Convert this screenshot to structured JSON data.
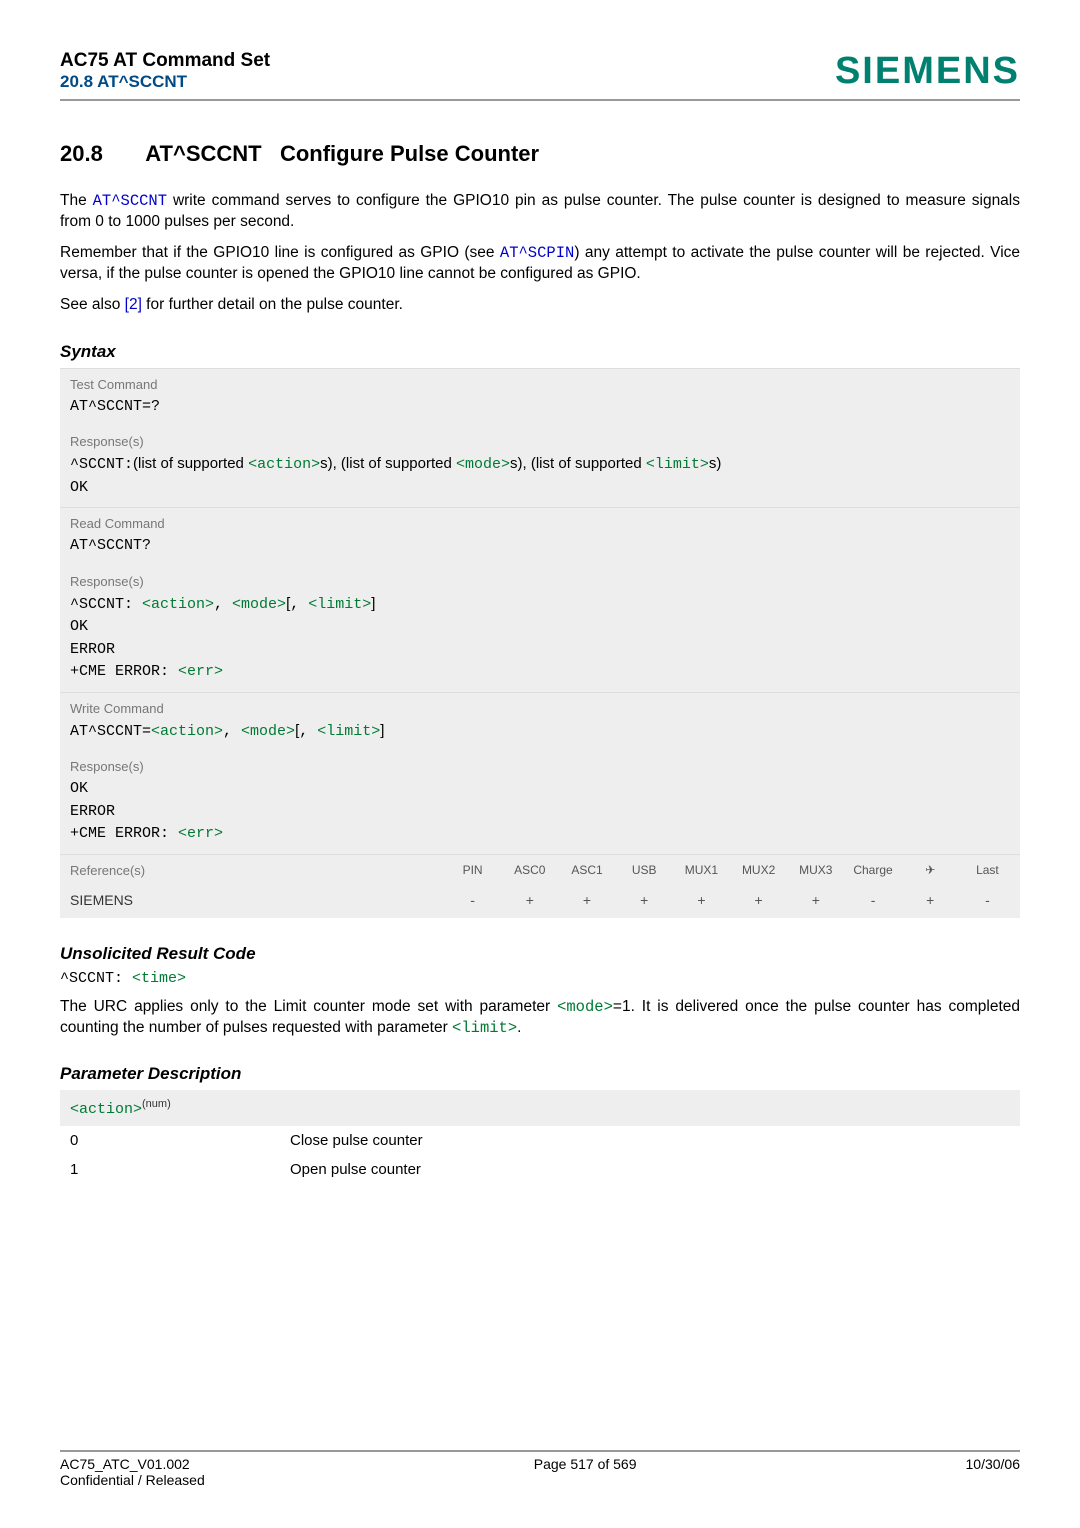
{
  "header": {
    "doc_title": "AC75 AT Command Set",
    "doc_sub": "20.8 AT^SCCNT",
    "brand": "SIEMENS"
  },
  "section": {
    "number": "20.8",
    "cmd": "AT^SCCNT",
    "name": "Configure Pulse Counter"
  },
  "intro": {
    "p1a": "The ",
    "p1b": " write command serves to configure the GPIO10 pin as pulse counter. The pulse counter is designed to measure signals from 0 to 1000 pulses per second.",
    "p2a": "Remember that if the GPIO10 line is configured as GPIO (see ",
    "p2b": ") any attempt to activate the pulse counter will be rejected. Vice versa, if the pulse counter is opened the GPIO10 line cannot be configured as GPIO.",
    "p3a": "See also ",
    "p3b": " for further detail on the pulse counter.",
    "cmd_sccnt": "AT^SCCNT",
    "cmd_scpin": "AT^SCPIN",
    "ref2": "[2]"
  },
  "syntax": {
    "heading": "Syntax",
    "test_label": "Test Command",
    "test_cmd": "AT^SCCNT=?",
    "resp_label": "Response(s)",
    "test_resp_prefix": "^SCCNT:",
    "test_resp_t1": "(list of supported ",
    "test_resp_action": "<action>",
    "test_resp_t2": "s), (list of supported ",
    "test_resp_mode": "<mode>",
    "test_resp_t3": "s), (list of supported ",
    "test_resp_limit": "<limit>",
    "test_resp_t4": "s)",
    "ok": "OK",
    "read_label": "Read Command",
    "read_cmd": "AT^SCCNT?",
    "read_resp_prefix": "^SCCNT: ",
    "comma": ", ",
    "lbracket": "[",
    "rbracket": "]",
    "error": "ERROR",
    "cme": "+CME ERROR: ",
    "err_param": "<err>",
    "write_label": "Write Command",
    "write_cmd_prefix": "AT^SCCNT=",
    "ref_label": "Reference(s)",
    "siemens": "SIEMENS",
    "cols": {
      "pin": "PIN",
      "asc0": "ASC0",
      "asc1": "ASC1",
      "usb": "USB",
      "mux1": "MUX1",
      "mux2": "MUX2",
      "mux3": "MUX3",
      "charge": "Charge",
      "arrow": "✈",
      "last": "Last"
    },
    "vals": {
      "pin": "-",
      "asc0": "+",
      "asc1": "+",
      "usb": "+",
      "mux1": "+",
      "mux2": "+",
      "mux3": "+",
      "charge": "-",
      "arrow": "+",
      "last": "-"
    }
  },
  "urc": {
    "heading": "Unsolicited Result Code",
    "prefix": "^SCCNT: ",
    "time": "<time>",
    "desc1": "The URC applies only to the Limit counter mode set with parameter ",
    "mode": "<mode>",
    "desc2": "=1. It is delivered once the pulse counter has completed counting the number of pulses requested with parameter ",
    "limit": "<limit>",
    "period": "."
  },
  "params": {
    "heading": "Parameter Description",
    "action": "<action>",
    "num": "(num)",
    "r0k": "0",
    "r0v": "Close pulse counter",
    "r1k": "1",
    "r1v": "Open pulse counter"
  },
  "footer": {
    "l1": "AC75_ATC_V01.002",
    "l2": "Confidential / Released",
    "c": "Page 517 of 569",
    "r": "10/30/06"
  }
}
